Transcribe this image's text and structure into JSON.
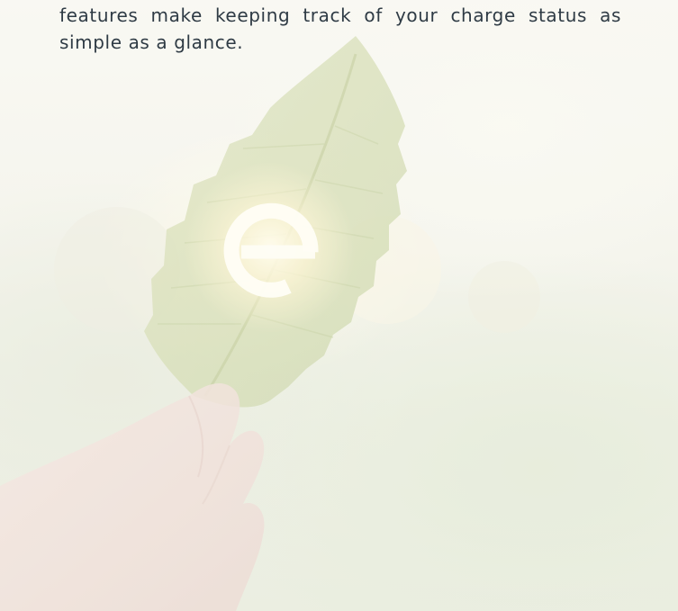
{
  "content": {
    "description_text": "features make keeping track of your charge status as simple as a glance."
  },
  "hero": {
    "image_subject": "hand holding leaf with e logo",
    "logo_icon": "e-letter-logo-icon"
  },
  "colors": {
    "text": "#2f3b45",
    "leaf": "#c9d39a",
    "skin": "#ecd7cf",
    "glow": "#fff6d6"
  }
}
